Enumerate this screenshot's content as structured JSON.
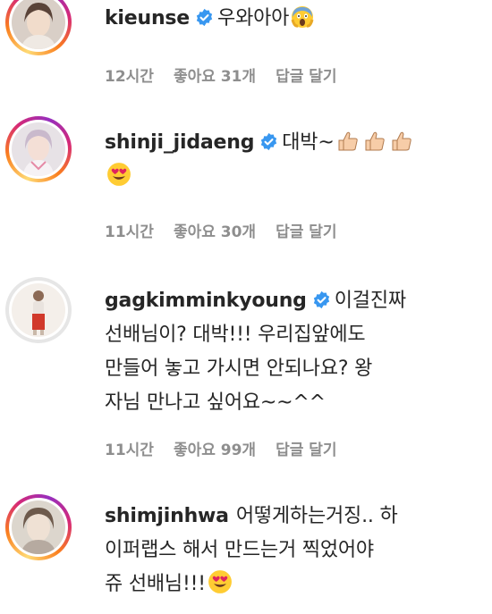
{
  "comments": [
    {
      "username": "kieunse",
      "text": "우와아아",
      "emoji": [
        "screaming-face"
      ],
      "time": "12시간",
      "likes": "좋아요 31개",
      "reply": "답글 달기"
    },
    {
      "username": "shinji_jidaeng",
      "text": "대박~",
      "emoji": [
        "thumbs-up",
        "thumbs-up",
        "thumbs-up",
        "heart-eyes"
      ],
      "time": "11시간",
      "likes": "좋아요 30개",
      "reply": "답글 달기"
    },
    {
      "username": "gagkimminkyoung",
      "text": "이걸진짜 선배님이? 대박!!! 우리집앞에도 만들어 놓고 가시면 안되나요? 왕자님 만나고 싶어요~~^^",
      "line1": "이걸진짜",
      "line2": "선배님이? 대박!!! 우리집앞에도",
      "line3": "만들어 놓고 가시면 안되나요? 왕",
      "line4": "자님 만나고 싶어요~~^^",
      "time": "11시간",
      "likes": "좋아요 99개",
      "reply": "답글 달기"
    },
    {
      "username": "shimjinhwa",
      "text": "어떻게하는거징.. 하이퍼랩스 해서 만드는거 찍었어야쥬 선배님!!!",
      "line1": "어떻게하는거징.. 하",
      "line2": "이퍼랩스 해서 만드는거 찍었어야",
      "line3": "쥬 선배님!!!",
      "emoji": [
        "heart-eyes"
      ]
    }
  ],
  "colors": {
    "verified": "#3897f0",
    "meta": "#8e8e8e",
    "text": "#262626"
  }
}
